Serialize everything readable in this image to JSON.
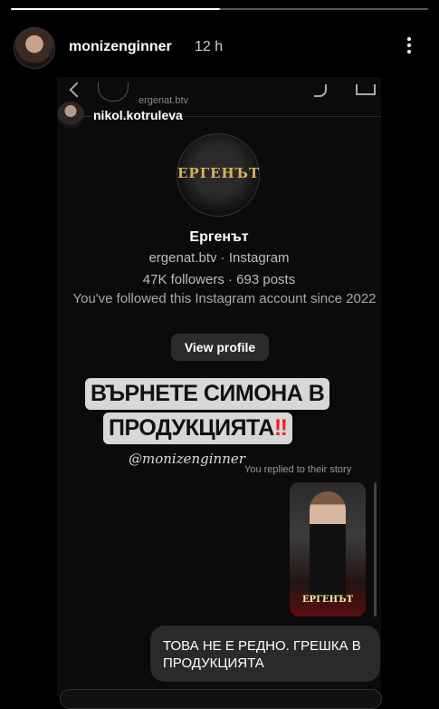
{
  "story": {
    "progress": 0.5,
    "username": "monizenginner",
    "time": "12 h"
  },
  "dm": {
    "top_handle": "ergenat.btv",
    "sender": "nikol.kotruleva",
    "profile": {
      "avatar_text": "ЕРГЕНЪТ",
      "name": "Ергенът",
      "handle_line": "ergenat.btv · Instagram",
      "stats": "47K followers · 693 posts",
      "followed_since": "You've followed this Instagram account since 2022",
      "view_button": "View profile"
    },
    "replied_label": "You replied to their story",
    "thumb_label": "ЕРГЕНЪТ",
    "reply_text": "ТОВА НЕ Е РЕДНО. ГРЕШКА В ПРОДУКЦИЯТА"
  },
  "sticker": {
    "line1": "ВЪРНЕТЕ СИМОНА В",
    "line2": "ПРОДУКЦИЯТА",
    "line2_mark": "‼",
    "mention": "@monizenginner"
  },
  "colors": {
    "accent_red": "#e22222",
    "sticker_bg": "#d7d7d7",
    "bubble_bg": "#2a2a2a"
  }
}
